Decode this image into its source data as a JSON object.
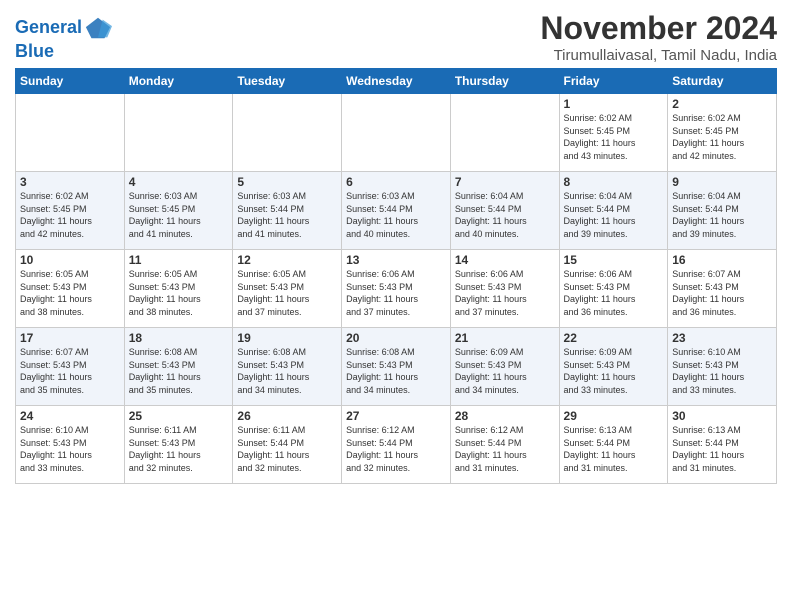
{
  "header": {
    "logo_line1": "General",
    "logo_line2": "Blue",
    "month": "November 2024",
    "location": "Tirumullaivasal, Tamil Nadu, India"
  },
  "weekdays": [
    "Sunday",
    "Monday",
    "Tuesday",
    "Wednesday",
    "Thursday",
    "Friday",
    "Saturday"
  ],
  "weeks": [
    [
      {
        "day": "",
        "info": ""
      },
      {
        "day": "",
        "info": ""
      },
      {
        "day": "",
        "info": ""
      },
      {
        "day": "",
        "info": ""
      },
      {
        "day": "",
        "info": ""
      },
      {
        "day": "1",
        "info": "Sunrise: 6:02 AM\nSunset: 5:45 PM\nDaylight: 11 hours\nand 43 minutes."
      },
      {
        "day": "2",
        "info": "Sunrise: 6:02 AM\nSunset: 5:45 PM\nDaylight: 11 hours\nand 42 minutes."
      }
    ],
    [
      {
        "day": "3",
        "info": "Sunrise: 6:02 AM\nSunset: 5:45 PM\nDaylight: 11 hours\nand 42 minutes."
      },
      {
        "day": "4",
        "info": "Sunrise: 6:03 AM\nSunset: 5:45 PM\nDaylight: 11 hours\nand 41 minutes."
      },
      {
        "day": "5",
        "info": "Sunrise: 6:03 AM\nSunset: 5:44 PM\nDaylight: 11 hours\nand 41 minutes."
      },
      {
        "day": "6",
        "info": "Sunrise: 6:03 AM\nSunset: 5:44 PM\nDaylight: 11 hours\nand 40 minutes."
      },
      {
        "day": "7",
        "info": "Sunrise: 6:04 AM\nSunset: 5:44 PM\nDaylight: 11 hours\nand 40 minutes."
      },
      {
        "day": "8",
        "info": "Sunrise: 6:04 AM\nSunset: 5:44 PM\nDaylight: 11 hours\nand 39 minutes."
      },
      {
        "day": "9",
        "info": "Sunrise: 6:04 AM\nSunset: 5:44 PM\nDaylight: 11 hours\nand 39 minutes."
      }
    ],
    [
      {
        "day": "10",
        "info": "Sunrise: 6:05 AM\nSunset: 5:43 PM\nDaylight: 11 hours\nand 38 minutes."
      },
      {
        "day": "11",
        "info": "Sunrise: 6:05 AM\nSunset: 5:43 PM\nDaylight: 11 hours\nand 38 minutes."
      },
      {
        "day": "12",
        "info": "Sunrise: 6:05 AM\nSunset: 5:43 PM\nDaylight: 11 hours\nand 37 minutes."
      },
      {
        "day": "13",
        "info": "Sunrise: 6:06 AM\nSunset: 5:43 PM\nDaylight: 11 hours\nand 37 minutes."
      },
      {
        "day": "14",
        "info": "Sunrise: 6:06 AM\nSunset: 5:43 PM\nDaylight: 11 hours\nand 37 minutes."
      },
      {
        "day": "15",
        "info": "Sunrise: 6:06 AM\nSunset: 5:43 PM\nDaylight: 11 hours\nand 36 minutes."
      },
      {
        "day": "16",
        "info": "Sunrise: 6:07 AM\nSunset: 5:43 PM\nDaylight: 11 hours\nand 36 minutes."
      }
    ],
    [
      {
        "day": "17",
        "info": "Sunrise: 6:07 AM\nSunset: 5:43 PM\nDaylight: 11 hours\nand 35 minutes."
      },
      {
        "day": "18",
        "info": "Sunrise: 6:08 AM\nSunset: 5:43 PM\nDaylight: 11 hours\nand 35 minutes."
      },
      {
        "day": "19",
        "info": "Sunrise: 6:08 AM\nSunset: 5:43 PM\nDaylight: 11 hours\nand 34 minutes."
      },
      {
        "day": "20",
        "info": "Sunrise: 6:08 AM\nSunset: 5:43 PM\nDaylight: 11 hours\nand 34 minutes."
      },
      {
        "day": "21",
        "info": "Sunrise: 6:09 AM\nSunset: 5:43 PM\nDaylight: 11 hours\nand 34 minutes."
      },
      {
        "day": "22",
        "info": "Sunrise: 6:09 AM\nSunset: 5:43 PM\nDaylight: 11 hours\nand 33 minutes."
      },
      {
        "day": "23",
        "info": "Sunrise: 6:10 AM\nSunset: 5:43 PM\nDaylight: 11 hours\nand 33 minutes."
      }
    ],
    [
      {
        "day": "24",
        "info": "Sunrise: 6:10 AM\nSunset: 5:43 PM\nDaylight: 11 hours\nand 33 minutes."
      },
      {
        "day": "25",
        "info": "Sunrise: 6:11 AM\nSunset: 5:43 PM\nDaylight: 11 hours\nand 32 minutes."
      },
      {
        "day": "26",
        "info": "Sunrise: 6:11 AM\nSunset: 5:44 PM\nDaylight: 11 hours\nand 32 minutes."
      },
      {
        "day": "27",
        "info": "Sunrise: 6:12 AM\nSunset: 5:44 PM\nDaylight: 11 hours\nand 32 minutes."
      },
      {
        "day": "28",
        "info": "Sunrise: 6:12 AM\nSunset: 5:44 PM\nDaylight: 11 hours\nand 31 minutes."
      },
      {
        "day": "29",
        "info": "Sunrise: 6:13 AM\nSunset: 5:44 PM\nDaylight: 11 hours\nand 31 minutes."
      },
      {
        "day": "30",
        "info": "Sunrise: 6:13 AM\nSunset: 5:44 PM\nDaylight: 11 hours\nand 31 minutes."
      }
    ]
  ]
}
